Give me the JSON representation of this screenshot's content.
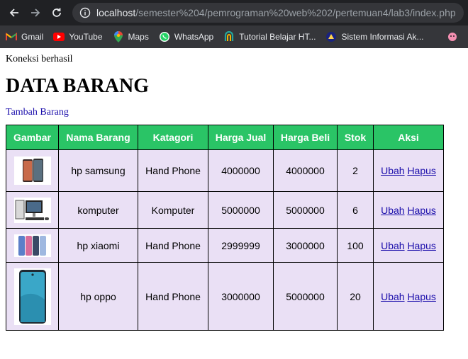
{
  "browser": {
    "url_host": "localhost",
    "url_path": "/semester%204/pemrograman%20web%202/pertemuan4/lab3/index.php",
    "bookmarks": [
      {
        "label": "Gmail",
        "icon": "gmail-icon"
      },
      {
        "label": "YouTube",
        "icon": "youtube-icon"
      },
      {
        "label": "Maps",
        "icon": "maps-icon"
      },
      {
        "label": "WhatsApp",
        "icon": "whatsapp-icon"
      },
      {
        "label": "Tutorial Belajar HT...",
        "icon": "tutorial-icon"
      },
      {
        "label": "Sistem Informasi Ak...",
        "icon": "sistem-informasi-icon"
      }
    ]
  },
  "page": {
    "status": "Koneksi berhasil",
    "title": "DATA BARANG",
    "add_link": "Tambah Barang"
  },
  "table": {
    "headers": [
      "Gambar",
      "Nama Barang",
      "Katagori",
      "Harga Jual",
      "Harga Beli",
      "Stok",
      "Aksi"
    ],
    "rows": [
      {
        "image": "phone-samsung-image",
        "nama": "hp samsung",
        "kategori": "Hand Phone",
        "jual": "4000000",
        "beli": "4000000",
        "stok": "2",
        "ubah": "Ubah",
        "hapus": "Hapus"
      },
      {
        "image": "computer-image",
        "nama": "komputer",
        "kategori": "Komputer",
        "jual": "5000000",
        "beli": "5000000",
        "stok": "6",
        "ubah": "Ubah",
        "hapus": "Hapus"
      },
      {
        "image": "phone-xiaomi-image",
        "nama": "hp xiaomi",
        "kategori": "Hand Phone",
        "jual": "2999999",
        "beli": "3000000",
        "stok": "100",
        "ubah": "Ubah",
        "hapus": "Hapus"
      },
      {
        "image": "phone-oppo-image",
        "nama": "hp oppo",
        "kategori": "Hand Phone",
        "jual": "3000000",
        "beli": "5000000",
        "stok": "20",
        "ubah": "Ubah",
        "hapus": "Hapus"
      }
    ]
  }
}
